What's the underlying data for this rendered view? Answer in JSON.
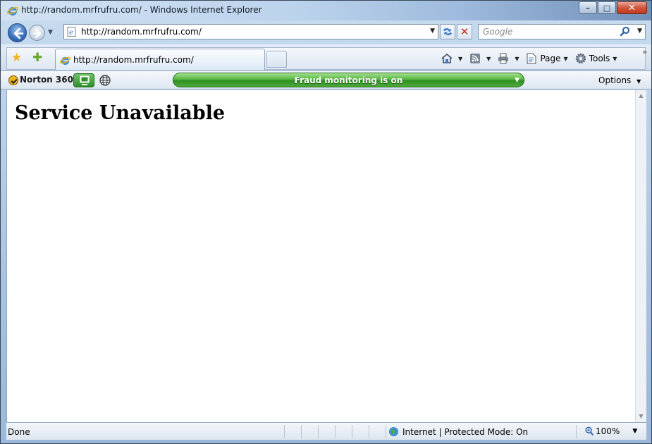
{
  "window": {
    "title": "http://random.mrfrufru.com/ - Windows Internet Explorer",
    "controls": {
      "minimize": "–",
      "maximize": "□",
      "close": "✕"
    }
  },
  "address": {
    "url": "http://random.mrfrufru.com/",
    "search_placeholder": "Google"
  },
  "tabs": [
    {
      "label": "http://random.mrfrufru.com/"
    }
  ],
  "commands": {
    "page": "Page",
    "tools": "Tools",
    "more": "»"
  },
  "norton": {
    "name": "Norton 360",
    "fraud_status": "Fraud monitoring is on",
    "options_label": "Options"
  },
  "page": {
    "heading": "Service Unavailable"
  },
  "status": {
    "left_text": "Done",
    "zone_text": "Internet | Protected Mode: On",
    "zoom_text": "100%"
  },
  "colors": {
    "fraud_bar": "#4fab3c",
    "norton_logo": "#f1b51c",
    "ie_accent": "#1d4c8f"
  }
}
